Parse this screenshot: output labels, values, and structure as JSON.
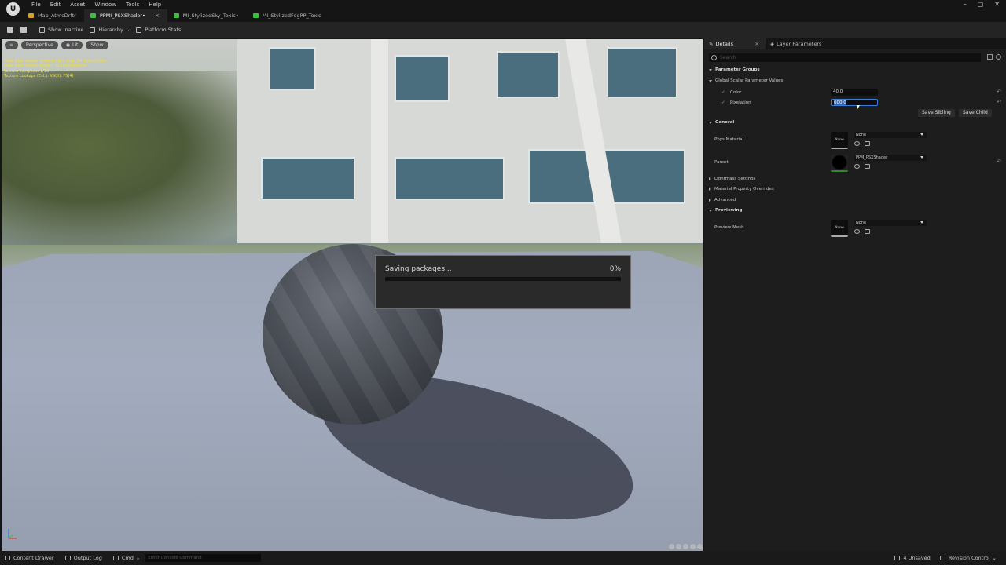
{
  "menu": [
    "File",
    "Edit",
    "Asset",
    "Window",
    "Tools",
    "Help"
  ],
  "tabs": [
    {
      "label": "Map_AtmcDrftr",
      "active": false,
      "color": "#d0a030"
    },
    {
      "label": "PPMI_PSXShader•",
      "active": true,
      "color": "#3ac03a"
    },
    {
      "label": "MI_StylizedSky_Toxic•",
      "active": false,
      "color": "#3ac03a"
    },
    {
      "label": "MI_StylizedFogPP_Toxic",
      "active": false,
      "color": "#3ac03a"
    }
  ],
  "window_buttons": [
    "–",
    "▢",
    "✕"
  ],
  "toolbar": {
    "show_inactive": "Show Inactive",
    "hierarchy": "Hierarchy",
    "platform_stats": "Platform Stats"
  },
  "viewport": {
    "perspective": "Perspective",
    "lit": "Lit",
    "show": "Show",
    "stats": [
      "Base pass shader without light map: 84 instructions",
      "Base pass vertex shader: 129 instructions",
      "Texture samplers: 1/16",
      "Texture Lookups (Est.): VS(0), PS(4)"
    ]
  },
  "dialog": {
    "message": "Saving packages...",
    "percent_label": "0%",
    "progress": 0
  },
  "details": {
    "tab_details": "Details",
    "tab_layer": "Layer Parameters",
    "search_placeholder": "Search",
    "parameter_groups": "Parameter Groups",
    "global_scalar": "Global Scalar Parameter Values",
    "color_label": "Color",
    "color_value": "40.0",
    "pixelation_label": "Pixelation",
    "pixelation_value": "600.0",
    "save_sibling": "Save Sibling",
    "save_child": "Save Child",
    "general": "General",
    "phys_material": "Phys Material",
    "phys_thumb": "None",
    "phys_combo": "None",
    "parent": "Parent",
    "parent_combo": "PPM_PSXShader",
    "lightmass": "Lightmass Settings",
    "material_overrides": "Material Property Overrides",
    "advanced": "Advanced",
    "previewing": "Previewing",
    "preview_mesh": "Preview Mesh",
    "preview_thumb": "None",
    "preview_combo": "None"
  },
  "statusbar": {
    "content_drawer": "Content Drawer",
    "output_log": "Output Log",
    "cmd": "Cmd",
    "console_placeholder": "Enter Console Command",
    "unsaved": "4 Unsaved",
    "revision_control": "Revision Control"
  }
}
